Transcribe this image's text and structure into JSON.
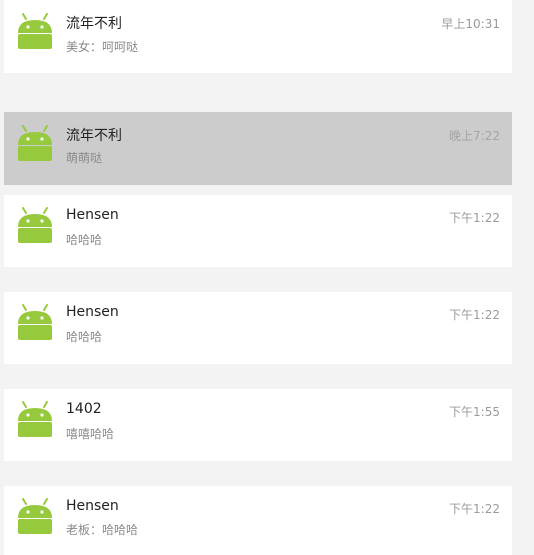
{
  "colors": {
    "background": "#f3f3f3",
    "card": "#ffffff",
    "selected_card": "#cccccc",
    "android_green": "#97C93D",
    "name_text": "#222222",
    "message_text": "#8a8a8a",
    "time_text": "#9b9b9b"
  },
  "conversations": [
    {
      "name": "流年不利",
      "message": "美女：呵呵哒",
      "time": "早上10:31",
      "avatar_icon": "android-robot-icon",
      "selected": false
    },
    {
      "name": "流年不利",
      "message": "萌萌哒",
      "time": "晚上7:22",
      "avatar_icon": "android-robot-icon",
      "selected": true
    },
    {
      "name": "Hensen",
      "message": "哈哈哈",
      "time": "下午1:22",
      "avatar_icon": "android-robot-icon",
      "selected": false
    },
    {
      "name": "Hensen",
      "message": "哈哈哈",
      "time": "下午1:22",
      "avatar_icon": "android-robot-icon",
      "selected": false
    },
    {
      "name": "1402",
      "message": "嘻嘻哈哈",
      "time": "下午1:55",
      "avatar_icon": "android-robot-icon",
      "selected": false
    },
    {
      "name": "Hensen",
      "message": "老板：哈哈哈",
      "time": "下午1:22",
      "avatar_icon": "android-robot-icon",
      "selected": false
    }
  ]
}
